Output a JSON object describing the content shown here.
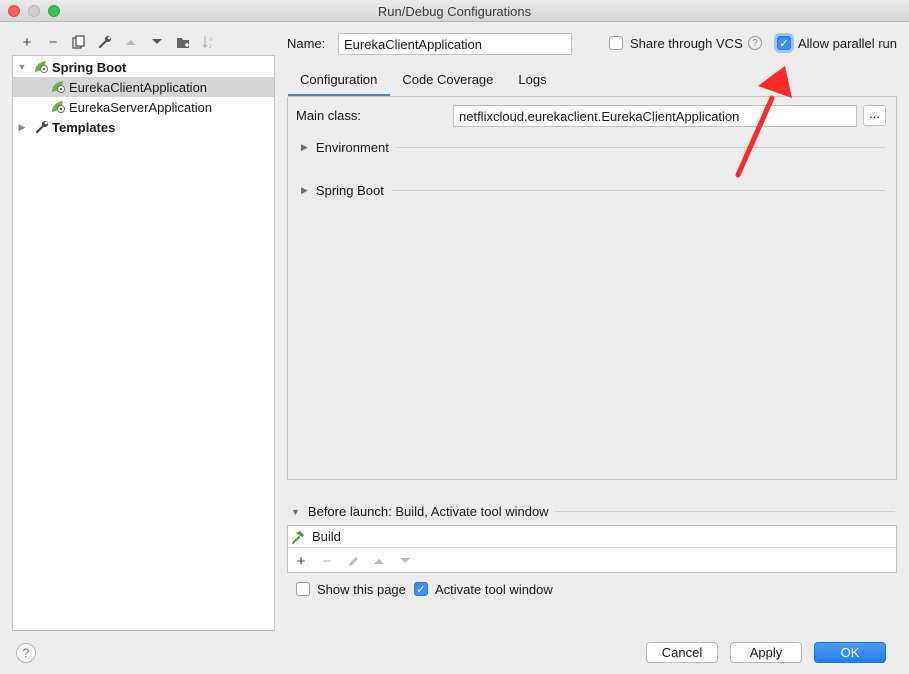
{
  "window": {
    "title": "Run/Debug Configurations"
  },
  "toolbar": {
    "icons": [
      "add-icon",
      "remove-icon",
      "copy-icon",
      "wrench-icon",
      "move-up-icon",
      "move-down-icon",
      "new-folder-icon",
      "sort-icon"
    ],
    "add": "+",
    "remove": "−"
  },
  "tree": {
    "groups": [
      {
        "label": "Spring Boot",
        "expanded": true
      },
      {
        "label": "Templates",
        "expanded": false
      }
    ],
    "items": [
      {
        "label": "EurekaClientApplication",
        "selected": true
      },
      {
        "label": "EurekaServerApplication",
        "selected": false
      }
    ]
  },
  "name_field": {
    "label": "Name:",
    "value": "EurekaClientApplication"
  },
  "share_vcs": {
    "label": "Share through VCS",
    "checked": false
  },
  "help_mark": "?",
  "parallel_run": {
    "label": "Allow parallel run",
    "checked": true
  },
  "tabs": [
    {
      "label": "Configuration",
      "active": true
    },
    {
      "label": "Code Coverage",
      "active": false
    },
    {
      "label": "Logs",
      "active": false
    }
  ],
  "main_class": {
    "label": "Main class:",
    "value": "netflixcloud.eurekaclient.EurekaClientApplication",
    "browse": "..."
  },
  "sections": [
    {
      "label": "Environment"
    },
    {
      "label": "Spring Boot"
    }
  ],
  "before_launch": {
    "header": "Before launch: Build, Activate tool window",
    "items": [
      {
        "label": "Build"
      }
    ],
    "add": "+",
    "remove": "−"
  },
  "show_page": {
    "label": "Show this page",
    "checked": false
  },
  "activate_tool_window": {
    "label": "Activate tool window",
    "checked": true
  },
  "buttons": {
    "cancel": "Cancel",
    "apply": "Apply",
    "ok": "OK"
  },
  "colors": {
    "accent": "#3d8ff5",
    "annotation_arrow": "#ff2a2a",
    "spring_green": "#6db33f"
  }
}
